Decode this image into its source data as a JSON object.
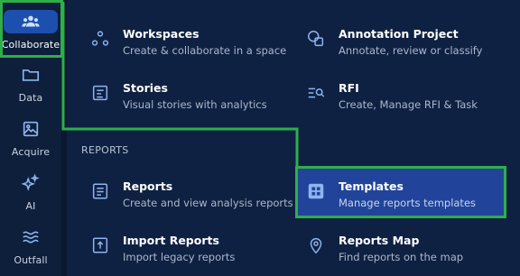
{
  "rail": {
    "items": [
      {
        "label": "Collaborate",
        "icon": "people-icon",
        "active": true
      },
      {
        "label": "Data",
        "icon": "folder-icon"
      },
      {
        "label": "Acquire",
        "icon": "image-icon"
      },
      {
        "label": "AI",
        "icon": "sparkle-icon"
      },
      {
        "label": "Outfall",
        "icon": "waves-icon"
      }
    ]
  },
  "menu": {
    "workspaces": {
      "title": "Workspaces",
      "desc": "Create & collaborate in a space",
      "icon": "nodes-icon"
    },
    "annotation": {
      "title": "Annotation Project",
      "desc": "Annotate, review or classify",
      "icon": "annotate-icon"
    },
    "stories": {
      "title": "Stories",
      "desc": "Visual stories with analytics",
      "icon": "story-icon"
    },
    "rfi": {
      "title": "RFI",
      "desc": "Create, Manage RFI & Task",
      "icon": "search-list-icon"
    },
    "reports_section": "REPORTS",
    "reports": {
      "title": "Reports",
      "desc": "Create and view analysis reports",
      "icon": "report-icon"
    },
    "templates": {
      "title": "Templates",
      "desc": "Manage reports templates",
      "icon": "grid-icon",
      "selected": true
    },
    "import_reports": {
      "title": "Import Reports",
      "desc": "Import legacy reports",
      "icon": "upload-file-icon"
    },
    "reports_map": {
      "title": "Reports Map",
      "desc": "Find reports on the map",
      "icon": "map-pin-icon"
    }
  },
  "colors": {
    "background": "#0b1a33",
    "panel": "#0f2142",
    "accent": "#1d4fae",
    "selected": "#21449a",
    "highlight": "#2fae4a",
    "icon": "#8fb4f0"
  }
}
